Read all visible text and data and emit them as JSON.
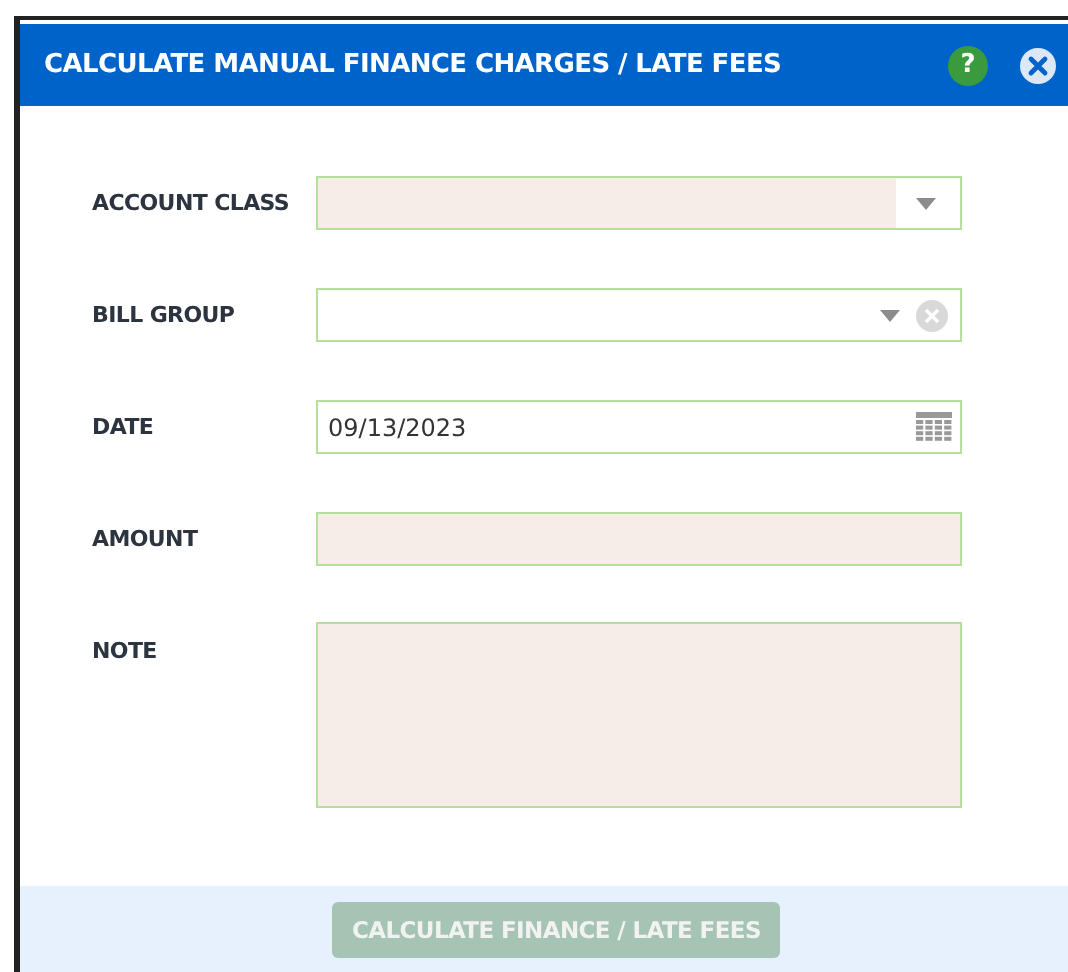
{
  "window": {
    "title": "CALCULATE MANUAL FINANCE CHARGES / LATE FEES",
    "help": "?"
  },
  "fields": [
    {
      "label": "ACCOUNT CLASS",
      "kind": "select",
      "required": true
    },
    {
      "label": "BILL GROUP",
      "kind": "select-clearable",
      "required": false
    },
    {
      "label": "DATE",
      "kind": "date",
      "required": false,
      "value": "09/13/2023"
    },
    {
      "label": "AMOUNT",
      "kind": "text",
      "required": true
    },
    {
      "label": "NOTE",
      "kind": "textarea",
      "required": true
    }
  ],
  "button": {
    "label": "CALCULATE FINANCE / LATE FEES",
    "disabled": true
  }
}
